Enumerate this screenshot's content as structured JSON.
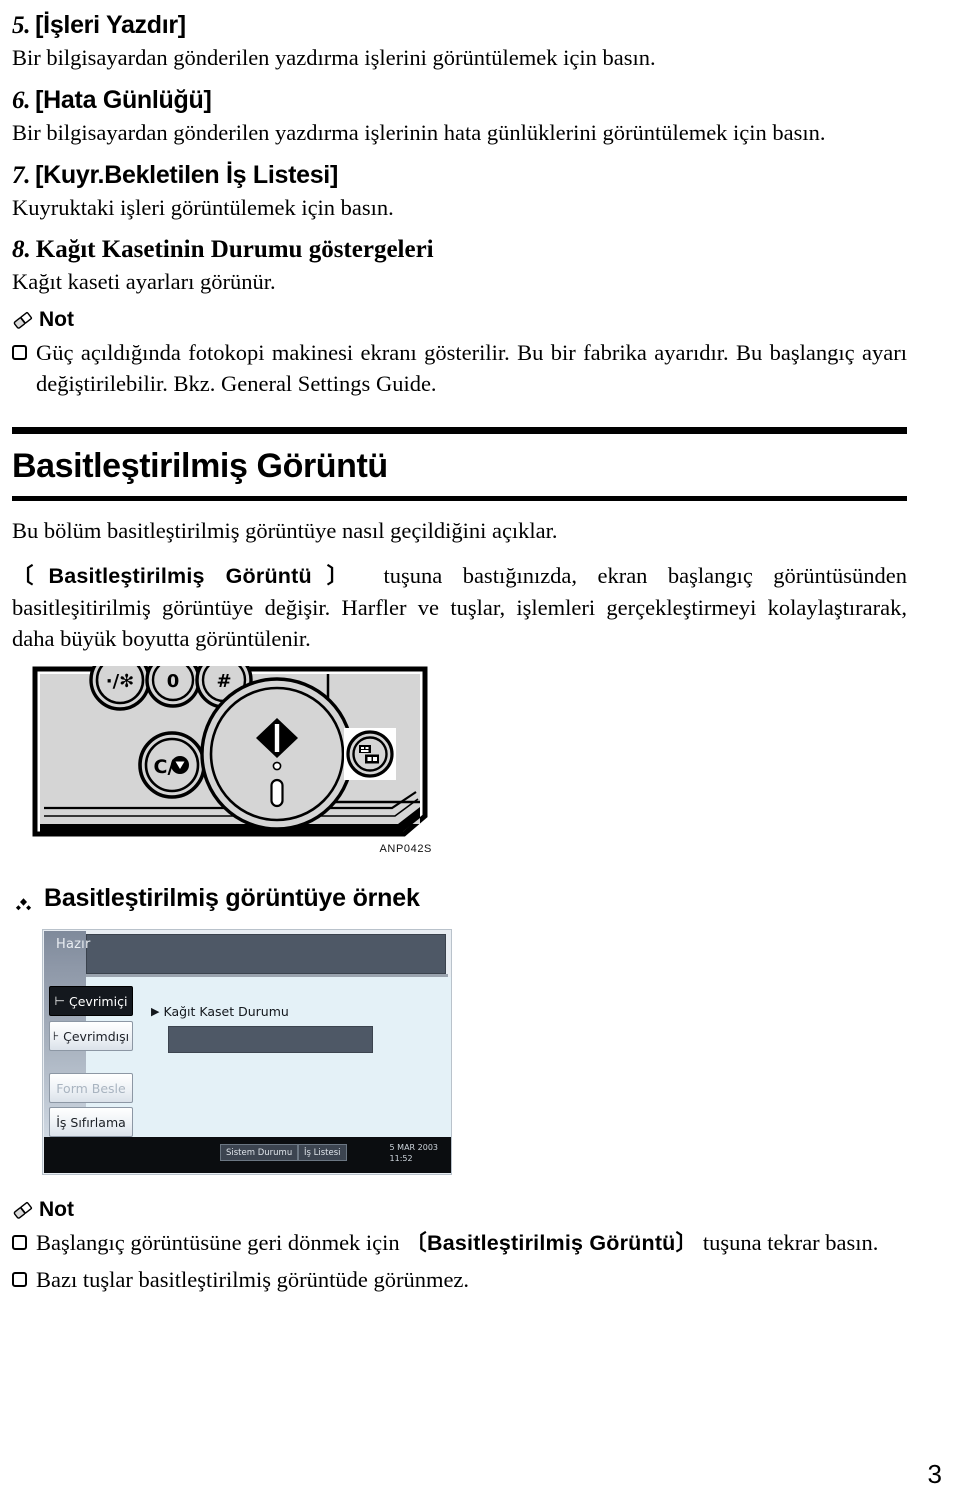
{
  "items": [
    {
      "number": "5.",
      "heading": "[İşleri Yazdır]",
      "body": "Bir bilgisayardan gönderilen yazdırma işlerini görüntülemek için basın."
    },
    {
      "number": "6.",
      "heading": "[Hata Günlüğü]",
      "body": "Bir bilgisayardan gönderilen yazdırma işlerinin hata günlüklerini görüntülemek için basın."
    },
    {
      "number": "7.",
      "heading": "[Kuyr.Bekletilen İş Listesi]",
      "body": "Kuyruktaki işleri görüntülemek için basın."
    },
    {
      "number": "8.",
      "heading": "Kağıt Kasetinin Durumu göstergeleri",
      "body": "Kağıt kaseti ayarları görünür."
    }
  ],
  "note_top": {
    "title": "Not",
    "icon": "pencil-icon",
    "bullets": [
      "Güç açıldığında fotokopi makinesi ekranı gösterilir. Bu bir fabrika ayarıdır. Bu başlangıç ayarı değiştirilebilir. Bkz. General Settings Guide."
    ]
  },
  "section": {
    "title": "Basitleştirilmiş Görüntü",
    "intro": "Bu bölüm basitleştirilmiş görüntüye nasıl geçildiğini açıklar.",
    "para_key": "〔Basitleştirilmiş Görüntü〕",
    "para_rest": " tuşuna bastığınızda, ekran başlangıç görüntüsünden basitleşitirilmiş görüntüye değişir. Harfler ve tuşlar, işlemleri gerçekleştirmeyi kolaylaştırarak, daha büyük boyutta görüntülenir."
  },
  "figure": {
    "caption": "ANP042S",
    "keys": [
      {
        "label": "·/✱",
        "name": "asterisk-key"
      },
      {
        "label": "0",
        "name": "zero-key"
      },
      {
        "label": "#",
        "name": "hash-key"
      },
      {
        "label": "C/◉",
        "name": "clear-stop-key"
      }
    ],
    "start_key_name": "start-key",
    "simplified_display_key_name": "simplified-display-key"
  },
  "example": {
    "bullet": "diamond-bullet",
    "heading": "Basitleştirilmiş görüntüye örnek"
  },
  "lcd": {
    "status": "Hazır",
    "side_buttons": [
      {
        "label": "Çevrimiçi",
        "arrow": "⊢",
        "state": "selected"
      },
      {
        "label": "Çevrimdışı",
        "arrow": "⊦",
        "state": "normal"
      },
      {
        "label": "Form Besle",
        "arrow": "",
        "state": "disabled"
      },
      {
        "label": "İş Sıfırlama",
        "arrow": "",
        "state": "normal"
      }
    ],
    "content_label": "Kağıt Kaset Durumu",
    "footer_buttons": [
      "Sistem Durumu",
      "İş Listesi"
    ],
    "date": "5 MAR 2003",
    "time": "11:52"
  },
  "note_bottom": {
    "title": "Not",
    "icon": "pencil-icon",
    "bullet1_pre": "Başlangıç görüntüsüne geri dönmek için ",
    "bullet1_key": "〔Basitleştirilmiş Görüntü〕",
    "bullet1_post": " tuşuna tekrar basın.",
    "bullet2": "Bazı tuşlar basitleştirilmiş görüntüde görünmez."
  },
  "page_number": "3"
}
